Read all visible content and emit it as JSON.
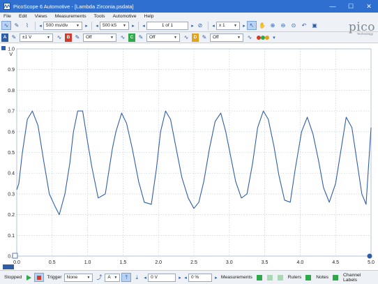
{
  "window": {
    "title": "PicoScope 6 Automotive - [Lambda Zirconia.psdata]",
    "minimize": "—",
    "maximize": "☐",
    "close": "✕"
  },
  "menu": [
    "File",
    "Edit",
    "Views",
    "Measurements",
    "Tools",
    "Automotive",
    "Help"
  ],
  "toolbar": {
    "timebase": "500 ms/div",
    "samples": "500 kS",
    "buffer": "1 of 1",
    "zoom": "x 1"
  },
  "channels": [
    {
      "label": "A",
      "color": "#2f5ea8",
      "range": "±1 V"
    },
    {
      "label": "B",
      "color": "#d43a2a",
      "range": "Off"
    },
    {
      "label": "C",
      "color": "#2fa84a",
      "range": "Off"
    },
    {
      "label": "D",
      "color": "#e2a21a",
      "range": "Off"
    }
  ],
  "logo": {
    "name": "pico",
    "tagline": "Technology"
  },
  "status": {
    "run_state": "Stopped",
    "trigger_label": "Trigger",
    "trigger_mode": "None",
    "trigger_channel": "A",
    "threshold": "0 V",
    "pretrigger": "0 %",
    "measurements": "Measurements",
    "rulers": "Rulers",
    "notes": "Notes",
    "channel_labels": "Channel Labels"
  },
  "chart_data": {
    "type": "line",
    "xlabel": "s",
    "ylabel": "V",
    "xlim": [
      0,
      5
    ],
    "ylim": [
      0,
      1
    ],
    "x_ticks": [
      "0.0",
      "0.5",
      "1.0",
      "1.5",
      "2.0",
      "2.5",
      "3.0",
      "3.5",
      "4.0",
      "4.5",
      "5.0"
    ],
    "y_ticks": [
      "0.0",
      "0.1",
      "0.2",
      "0.3",
      "0.4",
      "0.5",
      "0.6",
      "0.7",
      "0.8",
      "0.9",
      "1.0"
    ],
    "grid": true,
    "series": [
      {
        "color": "#2f5ea8",
        "x": [
          0.0,
          0.03,
          0.08,
          0.15,
          0.22,
          0.3,
          0.38,
          0.46,
          0.54,
          0.6,
          0.68,
          0.75,
          0.8,
          0.86,
          0.93,
          1.0,
          1.06,
          1.15,
          1.25,
          1.35,
          1.4,
          1.48,
          1.55,
          1.63,
          1.72,
          1.8,
          1.9,
          1.97,
          2.03,
          2.1,
          2.17,
          2.25,
          2.33,
          2.42,
          2.5,
          2.57,
          2.64,
          2.72,
          2.8,
          2.88,
          2.95,
          3.02,
          3.09,
          3.17,
          3.25,
          3.33,
          3.4,
          3.48,
          3.55,
          3.63,
          3.7,
          3.78,
          3.86,
          3.93,
          4.02,
          4.1,
          4.18,
          4.26,
          4.33,
          4.41,
          4.5,
          4.58,
          4.65,
          4.73,
          4.8,
          4.87,
          4.93,
          5.0
        ],
        "y": [
          0.32,
          0.35,
          0.5,
          0.66,
          0.7,
          0.63,
          0.46,
          0.3,
          0.24,
          0.2,
          0.3,
          0.45,
          0.6,
          0.7,
          0.7,
          0.55,
          0.43,
          0.28,
          0.3,
          0.52,
          0.6,
          0.69,
          0.64,
          0.52,
          0.36,
          0.26,
          0.25,
          0.42,
          0.6,
          0.7,
          0.66,
          0.52,
          0.38,
          0.28,
          0.23,
          0.26,
          0.36,
          0.52,
          0.65,
          0.69,
          0.6,
          0.48,
          0.36,
          0.28,
          0.3,
          0.45,
          0.62,
          0.7,
          0.66,
          0.53,
          0.39,
          0.27,
          0.26,
          0.42,
          0.6,
          0.67,
          0.59,
          0.46,
          0.33,
          0.26,
          0.35,
          0.52,
          0.67,
          0.62,
          0.46,
          0.3,
          0.25,
          0.62
        ]
      }
    ]
  }
}
